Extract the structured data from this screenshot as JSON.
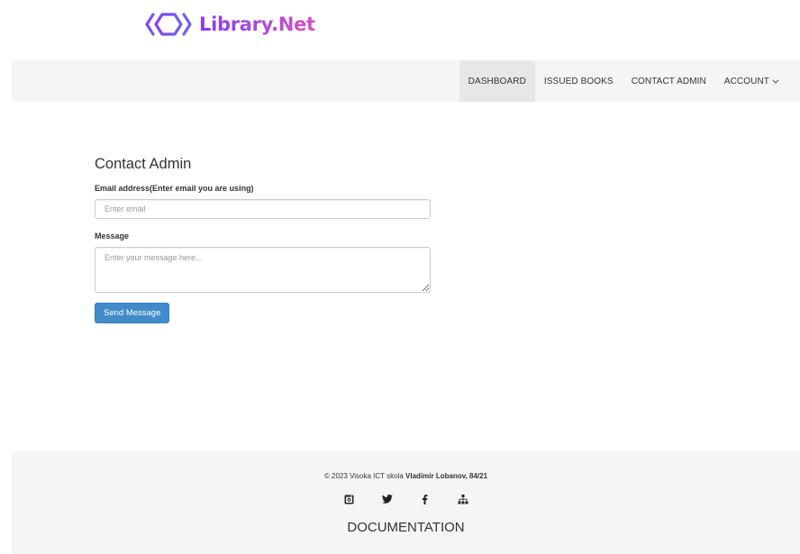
{
  "brand": {
    "name": "Library.Net",
    "logo_icon": "code-brackets-logo-icon"
  },
  "nav": {
    "items": [
      {
        "label": "DASHBOARD",
        "active": true
      },
      {
        "label": "ISSUED BOOKS",
        "active": false
      },
      {
        "label": "CONTACT ADMIN",
        "active": false
      },
      {
        "label": "ACCOUNT",
        "active": false,
        "icon": "chevron-down-icon"
      }
    ]
  },
  "form": {
    "title": "Contact Admin",
    "email_label": "Email address(Enter email you are using)",
    "email_placeholder": "Enter email",
    "email_value": "",
    "message_label": "Message",
    "message_placeholder": "Enter your message here...",
    "message_value": "",
    "submit_label": "Send Message"
  },
  "footer": {
    "copyright_prefix": "© 2023 Visoka ICT skola",
    "copyright_author": "Vladimir Lobanov, 84/21",
    "social_icons": [
      "instagram-icon",
      "twitter-icon",
      "facebook-icon",
      "sitemap-icon"
    ],
    "documentation_label": "DOCUMENTATION"
  },
  "colors": {
    "brand_gradient_start": "#8a3df0",
    "brand_gradient_end": "#d64fc4",
    "navbar_bg": "#f5f5f5",
    "nav_active_bg": "#e7e7e7",
    "button_primary": "#428bca"
  }
}
